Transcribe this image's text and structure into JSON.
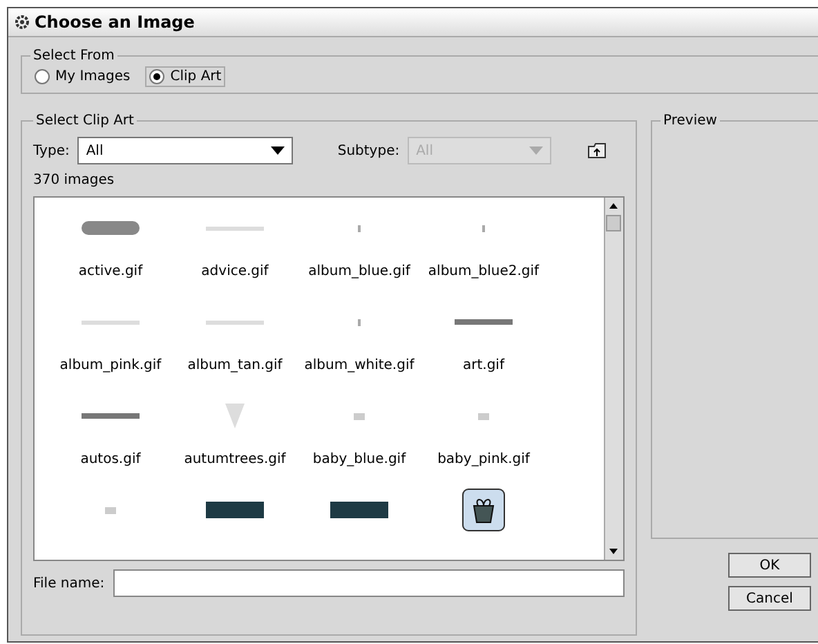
{
  "window": {
    "title": "Choose an Image"
  },
  "select_from": {
    "legend": "Select From",
    "options": [
      {
        "label": "My Images",
        "selected": false
      },
      {
        "label": "Clip Art",
        "selected": true
      }
    ]
  },
  "clip_art": {
    "legend": "Select Clip Art",
    "type_label": "Type:",
    "type_value": "All",
    "subtype_label": "Subtype:",
    "subtype_value": "All",
    "subtype_disabled": true,
    "count": "370 images",
    "items": [
      {
        "label": "active.gif",
        "kind": "pill"
      },
      {
        "label": "advice.gif",
        "kind": "line"
      },
      {
        "label": "album_blue.gif",
        "kind": "tick"
      },
      {
        "label": "album_blue2.gif",
        "kind": "tick"
      },
      {
        "label": "album_pink.gif",
        "kind": "line"
      },
      {
        "label": "album_tan.gif",
        "kind": "line"
      },
      {
        "label": "album_white.gif",
        "kind": "tick"
      },
      {
        "label": "art.gif",
        "kind": "bar"
      },
      {
        "label": "autos.gif",
        "kind": "bar"
      },
      {
        "label": "autumtrees.gif",
        "kind": "tree"
      },
      {
        "label": "baby_blue.gif",
        "kind": "dot"
      },
      {
        "label": "baby_pink.gif",
        "kind": "dot"
      },
      {
        "kind": "dot"
      },
      {
        "kind": "darkbar"
      },
      {
        "kind": "darkbar"
      },
      {
        "kind": "gift"
      }
    ],
    "file_name_label": "File name:"
  },
  "preview": {
    "legend": "Preview"
  },
  "buttons": [
    "OK",
    "Cancel"
  ]
}
